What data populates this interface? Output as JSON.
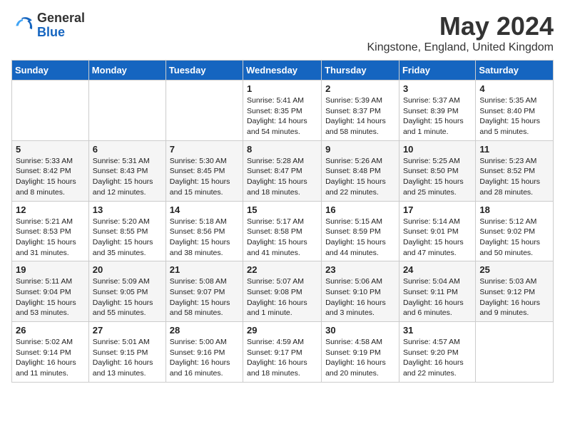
{
  "header": {
    "logo_general": "General",
    "logo_blue": "Blue",
    "month_title": "May 2024",
    "location": "Kingstone, England, United Kingdom"
  },
  "weekdays": [
    "Sunday",
    "Monday",
    "Tuesday",
    "Wednesday",
    "Thursday",
    "Friday",
    "Saturday"
  ],
  "weeks": [
    [
      {
        "day": "",
        "info": ""
      },
      {
        "day": "",
        "info": ""
      },
      {
        "day": "",
        "info": ""
      },
      {
        "day": "1",
        "info": "Sunrise: 5:41 AM\nSunset: 8:35 PM\nDaylight: 14 hours and 54 minutes."
      },
      {
        "day": "2",
        "info": "Sunrise: 5:39 AM\nSunset: 8:37 PM\nDaylight: 14 hours and 58 minutes."
      },
      {
        "day": "3",
        "info": "Sunrise: 5:37 AM\nSunset: 8:39 PM\nDaylight: 15 hours and 1 minute."
      },
      {
        "day": "4",
        "info": "Sunrise: 5:35 AM\nSunset: 8:40 PM\nDaylight: 15 hours and 5 minutes."
      }
    ],
    [
      {
        "day": "5",
        "info": "Sunrise: 5:33 AM\nSunset: 8:42 PM\nDaylight: 15 hours and 8 minutes."
      },
      {
        "day": "6",
        "info": "Sunrise: 5:31 AM\nSunset: 8:43 PM\nDaylight: 15 hours and 12 minutes."
      },
      {
        "day": "7",
        "info": "Sunrise: 5:30 AM\nSunset: 8:45 PM\nDaylight: 15 hours and 15 minutes."
      },
      {
        "day": "8",
        "info": "Sunrise: 5:28 AM\nSunset: 8:47 PM\nDaylight: 15 hours and 18 minutes."
      },
      {
        "day": "9",
        "info": "Sunrise: 5:26 AM\nSunset: 8:48 PM\nDaylight: 15 hours and 22 minutes."
      },
      {
        "day": "10",
        "info": "Sunrise: 5:25 AM\nSunset: 8:50 PM\nDaylight: 15 hours and 25 minutes."
      },
      {
        "day": "11",
        "info": "Sunrise: 5:23 AM\nSunset: 8:52 PM\nDaylight: 15 hours and 28 minutes."
      }
    ],
    [
      {
        "day": "12",
        "info": "Sunrise: 5:21 AM\nSunset: 8:53 PM\nDaylight: 15 hours and 31 minutes."
      },
      {
        "day": "13",
        "info": "Sunrise: 5:20 AM\nSunset: 8:55 PM\nDaylight: 15 hours and 35 minutes."
      },
      {
        "day": "14",
        "info": "Sunrise: 5:18 AM\nSunset: 8:56 PM\nDaylight: 15 hours and 38 minutes."
      },
      {
        "day": "15",
        "info": "Sunrise: 5:17 AM\nSunset: 8:58 PM\nDaylight: 15 hours and 41 minutes."
      },
      {
        "day": "16",
        "info": "Sunrise: 5:15 AM\nSunset: 8:59 PM\nDaylight: 15 hours and 44 minutes."
      },
      {
        "day": "17",
        "info": "Sunrise: 5:14 AM\nSunset: 9:01 PM\nDaylight: 15 hours and 47 minutes."
      },
      {
        "day": "18",
        "info": "Sunrise: 5:12 AM\nSunset: 9:02 PM\nDaylight: 15 hours and 50 minutes."
      }
    ],
    [
      {
        "day": "19",
        "info": "Sunrise: 5:11 AM\nSunset: 9:04 PM\nDaylight: 15 hours and 53 minutes."
      },
      {
        "day": "20",
        "info": "Sunrise: 5:09 AM\nSunset: 9:05 PM\nDaylight: 15 hours and 55 minutes."
      },
      {
        "day": "21",
        "info": "Sunrise: 5:08 AM\nSunset: 9:07 PM\nDaylight: 15 hours and 58 minutes."
      },
      {
        "day": "22",
        "info": "Sunrise: 5:07 AM\nSunset: 9:08 PM\nDaylight: 16 hours and 1 minute."
      },
      {
        "day": "23",
        "info": "Sunrise: 5:06 AM\nSunset: 9:10 PM\nDaylight: 16 hours and 3 minutes."
      },
      {
        "day": "24",
        "info": "Sunrise: 5:04 AM\nSunset: 9:11 PM\nDaylight: 16 hours and 6 minutes."
      },
      {
        "day": "25",
        "info": "Sunrise: 5:03 AM\nSunset: 9:12 PM\nDaylight: 16 hours and 9 minutes."
      }
    ],
    [
      {
        "day": "26",
        "info": "Sunrise: 5:02 AM\nSunset: 9:14 PM\nDaylight: 16 hours and 11 minutes."
      },
      {
        "day": "27",
        "info": "Sunrise: 5:01 AM\nSunset: 9:15 PM\nDaylight: 16 hours and 13 minutes."
      },
      {
        "day": "28",
        "info": "Sunrise: 5:00 AM\nSunset: 9:16 PM\nDaylight: 16 hours and 16 minutes."
      },
      {
        "day": "29",
        "info": "Sunrise: 4:59 AM\nSunset: 9:17 PM\nDaylight: 16 hours and 18 minutes."
      },
      {
        "day": "30",
        "info": "Sunrise: 4:58 AM\nSunset: 9:19 PM\nDaylight: 16 hours and 20 minutes."
      },
      {
        "day": "31",
        "info": "Sunrise: 4:57 AM\nSunset: 9:20 PM\nDaylight: 16 hours and 22 minutes."
      },
      {
        "day": "",
        "info": ""
      }
    ]
  ]
}
